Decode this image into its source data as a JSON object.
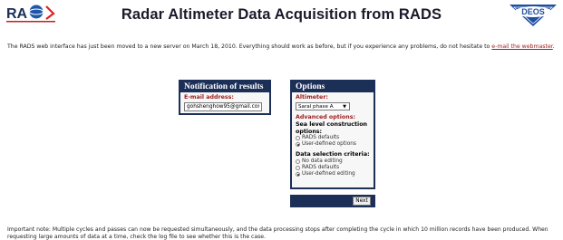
{
  "header": {
    "title": "Radar Altimeter Data Acquisition from RADS",
    "left_logo_text": "RADS",
    "right_logo_text": "DEOS"
  },
  "intro": {
    "text_before_link": "The RADS web interface has just been moved to a new server on March 18, 2010. Everything should work as before, but if you experience any problems, do not hesitate to ",
    "link_text": "e-mail the webmaster",
    "text_after_link": "."
  },
  "notification": {
    "title": "Notification of results",
    "email_label": "E-mail address:",
    "email_value": "gohshenghow95@gmail.com"
  },
  "options": {
    "title": "Options",
    "altimeter_label": "Altimeter:",
    "altimeter_selected": "Saral phase A",
    "advanced_label": "Advanced options:",
    "sea_level_label": "Sea level construction options:",
    "sea_level_options": [
      {
        "label": "RADS defaults",
        "checked": false
      },
      {
        "label": "User-defined options",
        "checked": true
      }
    ],
    "data_selection_label": "Data selection criteria:",
    "data_selection_options": [
      {
        "label": "No data editing",
        "checked": false
      },
      {
        "label": "RADS defaults",
        "checked": false
      },
      {
        "label": "User-defined editing",
        "checked": true
      }
    ]
  },
  "actions": {
    "next_label": "Next"
  },
  "footer": {
    "note": "Important note: Multiple cycles and passes can now be requested simultaneously, and the data processing stops after completing the cycle in which 10 million records have been produced. When requesting large amounts of data at a time, check the log file to see whether this is the case."
  },
  "colors": {
    "panel_header": "#1c2f57",
    "label_red": "#9b1b1b",
    "link": "#9a2020"
  }
}
